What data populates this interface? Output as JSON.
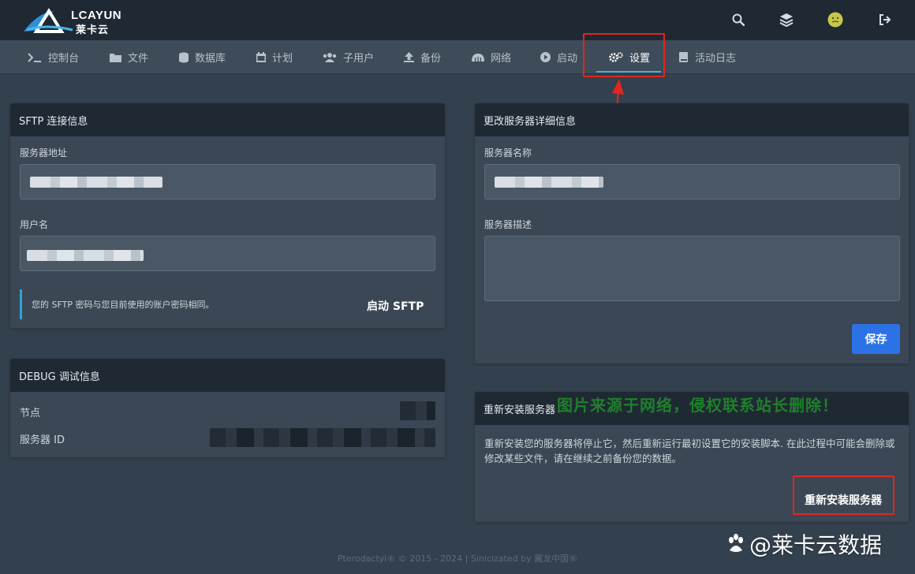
{
  "brand": {
    "name_en": "LCAYUN",
    "name_cn": "莱卡云"
  },
  "header_icons": [
    "search-icon",
    "layers-icon",
    "avatar",
    "logout-icon"
  ],
  "nav": {
    "items": [
      {
        "label": "控制台",
        "icon": "terminal-icon"
      },
      {
        "label": "文件",
        "icon": "folder-icon"
      },
      {
        "label": "数据库",
        "icon": "database-icon"
      },
      {
        "label": "计划",
        "icon": "calendar-icon"
      },
      {
        "label": "子用户",
        "icon": "users-icon"
      },
      {
        "label": "备份",
        "icon": "upload-icon"
      },
      {
        "label": "网络",
        "icon": "network-icon"
      },
      {
        "label": "启动",
        "icon": "play-icon"
      },
      {
        "label": "设置",
        "icon": "cogs-icon",
        "active": true
      },
      {
        "label": "活动日志",
        "icon": "book-icon"
      }
    ]
  },
  "sftp": {
    "title": "SFTP 连接信息",
    "address_label": "服务器地址",
    "username_label": "用户名",
    "note": "您的 SFTP 密码与您目前使用的账户密码相同。",
    "launch_label": "启动 SFTP"
  },
  "debug": {
    "title": "DEBUG 调试信息",
    "node_label": "节点",
    "server_id_label": "服务器 ID"
  },
  "details": {
    "title": "更改服务器详细信息",
    "name_label": "服务器名称",
    "description_label": "服务器描述",
    "save_label": "保存"
  },
  "reinstall": {
    "title": "重新安装服务器",
    "description": "重新安装您的服务器将停止它，然后重新运行最初设置它的安装脚本. 在此过程中可能会删除或修改某些文件，请在继续之前备份您的数据。",
    "button_label": "重新安装服务器"
  },
  "watermark_notice": "图片来源于网络，侵权联系站长删除！",
  "footer": "Pterodactyl® © 2015 - 2024 | Sinicizated by 冀龙中国®",
  "watermark_bottom": "@莱卡云数据",
  "colors": {
    "accent": "#4ab0d8",
    "primary_button": "#2b72e6",
    "highlight_red": "#e3261f"
  }
}
